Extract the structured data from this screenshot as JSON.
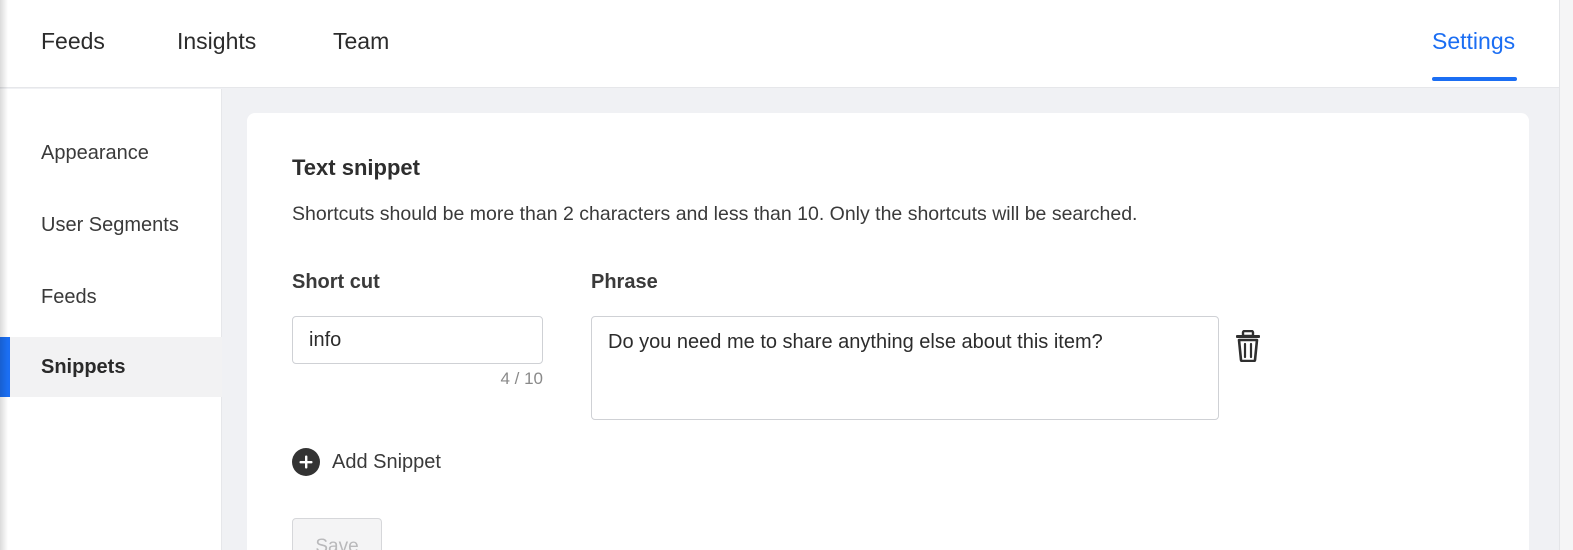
{
  "topnav": {
    "tabs": [
      {
        "label": "Feeds"
      },
      {
        "label": "Insights"
      },
      {
        "label": "Team"
      }
    ],
    "settings_label": "Settings"
  },
  "sidebar": {
    "items": [
      {
        "label": "Appearance"
      },
      {
        "label": "User Segments"
      },
      {
        "label": "Feeds"
      },
      {
        "label": "Snippets",
        "active": true
      }
    ]
  },
  "snippets": {
    "title": "Text snippet",
    "description": "Shortcuts should be more than 2 characters and less than 10. Only the shortcuts will be searched.",
    "shortcut_label": "Short cut",
    "phrase_label": "Phrase",
    "rows": [
      {
        "shortcut": "info",
        "char_count": "4 / 10",
        "phrase": "Do you need me to share anything else about this item?"
      }
    ],
    "add_label": "Add Snippet",
    "save_label": "Save"
  },
  "colors": {
    "accent": "#1b6ef3",
    "page_background": "#f0f1f4"
  },
  "icons": {
    "delete": "trash-icon",
    "add": "plus-circle-icon"
  }
}
